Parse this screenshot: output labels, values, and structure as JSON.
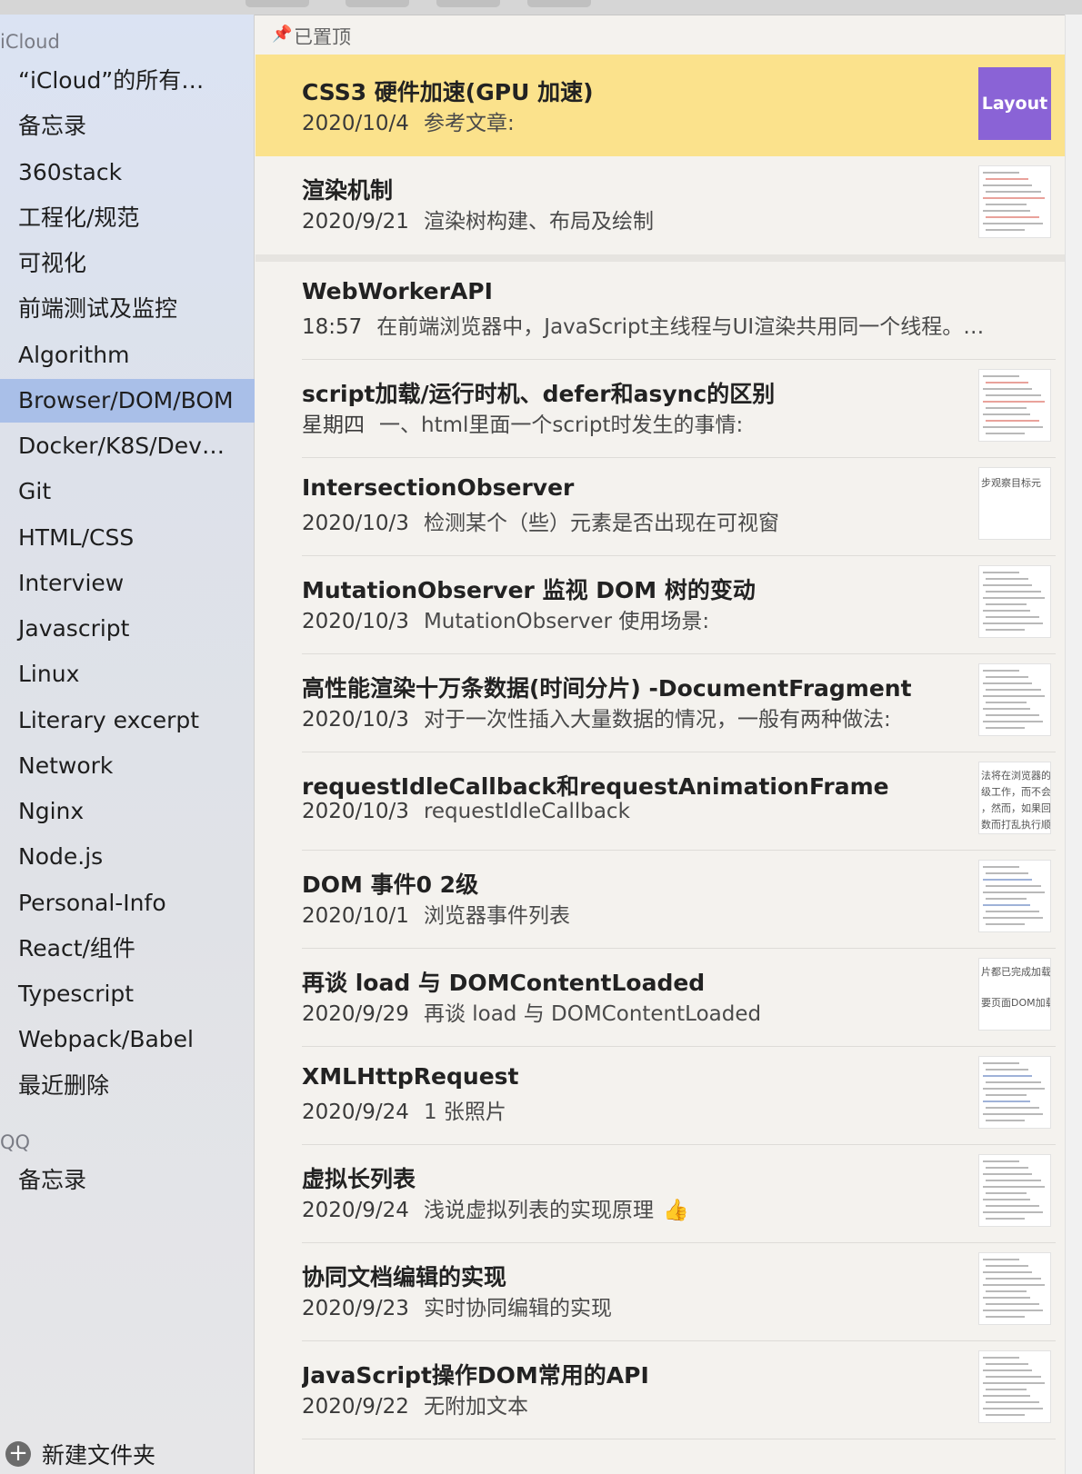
{
  "sidebar": {
    "accounts": [
      {
        "label": "iCloud",
        "folders": [
          "“iCloud”的所有…",
          "备忘录",
          "360stack",
          "工程化/规范",
          "可视化",
          "前端测试及监控",
          "Algorithm",
          "Browser/DOM/BOM",
          "Docker/K8S/Dev…",
          "Git",
          "HTML/CSS",
          "Interview",
          "Javascript",
          "Linux",
          "Literary excerpt",
          "Network",
          "Nginx",
          "Node.js",
          "Personal-Info",
          "React/组件",
          "Typescript",
          "Webpack/Babel",
          "最近删除"
        ]
      },
      {
        "label": "QQ",
        "folders": [
          "备忘录"
        ]
      }
    ],
    "selected_folder": "Browser/DOM/BOM",
    "new_folder_label": "新建文件夹"
  },
  "list": {
    "pinned_header": "已置顶",
    "notes": [
      {
        "title": "CSS3 硬件加速(GPU 加速)",
        "date": "2020/10/4",
        "snippet": "参考文章:",
        "thumb_text": "Layout",
        "pinned": true,
        "selected": true
      },
      {
        "title": "渲染机制",
        "date": "2020/9/21",
        "snippet": "渲染树构建、布局及绘制",
        "pinned": true
      },
      {
        "title": "WebWorkerAPI",
        "date": "18:57",
        "snippet": "在前端浏览器中，JavaScript主线程与UI渲染共用同一个线程。…"
      },
      {
        "title": "script加载/运行时机、defer和async的区别",
        "date": "星期四",
        "snippet": "一、html里面一个script时发生的事情:"
      },
      {
        "title": "IntersectionObserver",
        "date": "2020/10/3",
        "snippet": "检测某个（些）元素是否出现在可视窗",
        "thumb_text": "步观察目标元"
      },
      {
        "title": "MutationObserver 监视 DOM 树的变动",
        "date": "2020/10/3",
        "snippet": "MutationObserver 使用场景:"
      },
      {
        "title": "高性能渲染十万条数据(时间分片) -DocumentFragment",
        "date": "2020/10/3",
        "snippet": "对于一次性插入大量数据的情况，一般有两种做法:"
      },
      {
        "title": "requestIdleCallback和requestAnimationFrame",
        "date": "2020/10/3",
        "snippet": "requestIdleCallback",
        "thumb_lines": [
          "法将在浏览器的",
          "级工作，而不会",
          "，然而，如果回",
          "数而打乱执行顺"
        ]
      },
      {
        "title": "DOM 事件0 2级",
        "date": "2020/10/1",
        "snippet": "浏览器事件列表"
      },
      {
        "title": "再谈 load 与 DOMContentLoaded",
        "date": "2020/9/29",
        "snippet": "再谈 load 与 DOMContentLoaded",
        "thumb_lines": [
          "片都已完成加载",
          "要页面DOM加载"
        ]
      },
      {
        "title": "XMLHttpRequest",
        "date": "2020/9/24",
        "snippet": "1 张照片"
      },
      {
        "title": "虚拟长列表",
        "date": "2020/9/24",
        "snippet": "浅说虚拟列表的实现原理",
        "emoji": "👍"
      },
      {
        "title": "协同文档编辑的实现",
        "date": "2020/9/23",
        "snippet": "实时协同编辑的实现"
      },
      {
        "title": "JavaScript操作DOM常用的API",
        "date": "2020/9/22",
        "snippet": "无附加文本"
      }
    ]
  },
  "colors": {
    "selected_note": "#fbe28c",
    "selected_folder": "#a9bfe8",
    "layout_thumb": "#8a63d6"
  },
  "icons": {
    "pin": "pin-icon",
    "new_folder": "plus-circle-icon"
  }
}
